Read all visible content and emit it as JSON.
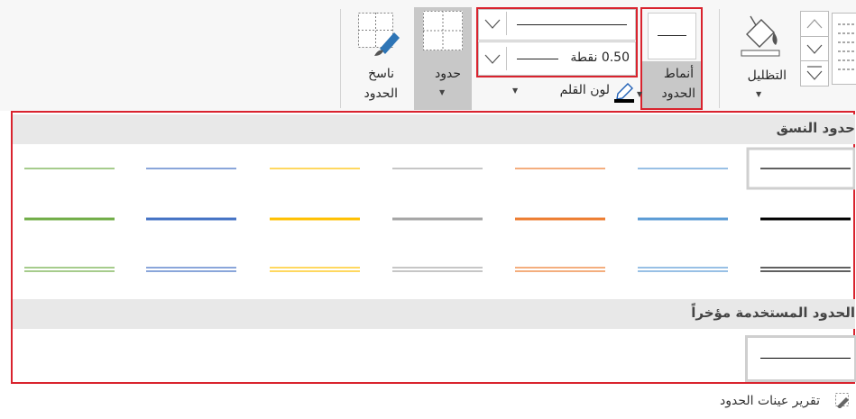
{
  "ribbon": {
    "shading_label": "التظليل",
    "border_styles_label_1": "أنماط",
    "border_styles_label_2": "الحدود",
    "pen_weight_value": "0.50 نقطة",
    "pen_color_label": "لون القلم",
    "borders_label": "حدود",
    "border_painter_label_1": "ناسخ",
    "border_painter_label_2": "الحدود",
    "highlight_color": "#d9232e"
  },
  "gallery": {
    "theme_borders_title": "حدود النسق",
    "recent_borders_title": "الحدود المستخدمة مؤخراً",
    "swatch_colors": [
      "#70ad47",
      "#4472c4",
      "#ffc000",
      "#a5a5a5",
      "#ed7d31",
      "#5b9bd5",
      "#000000"
    ],
    "row_styles": [
      "thin",
      "thick",
      "double"
    ]
  },
  "footer": {
    "border_sampler_label": "تقرير عينات الحدود"
  }
}
